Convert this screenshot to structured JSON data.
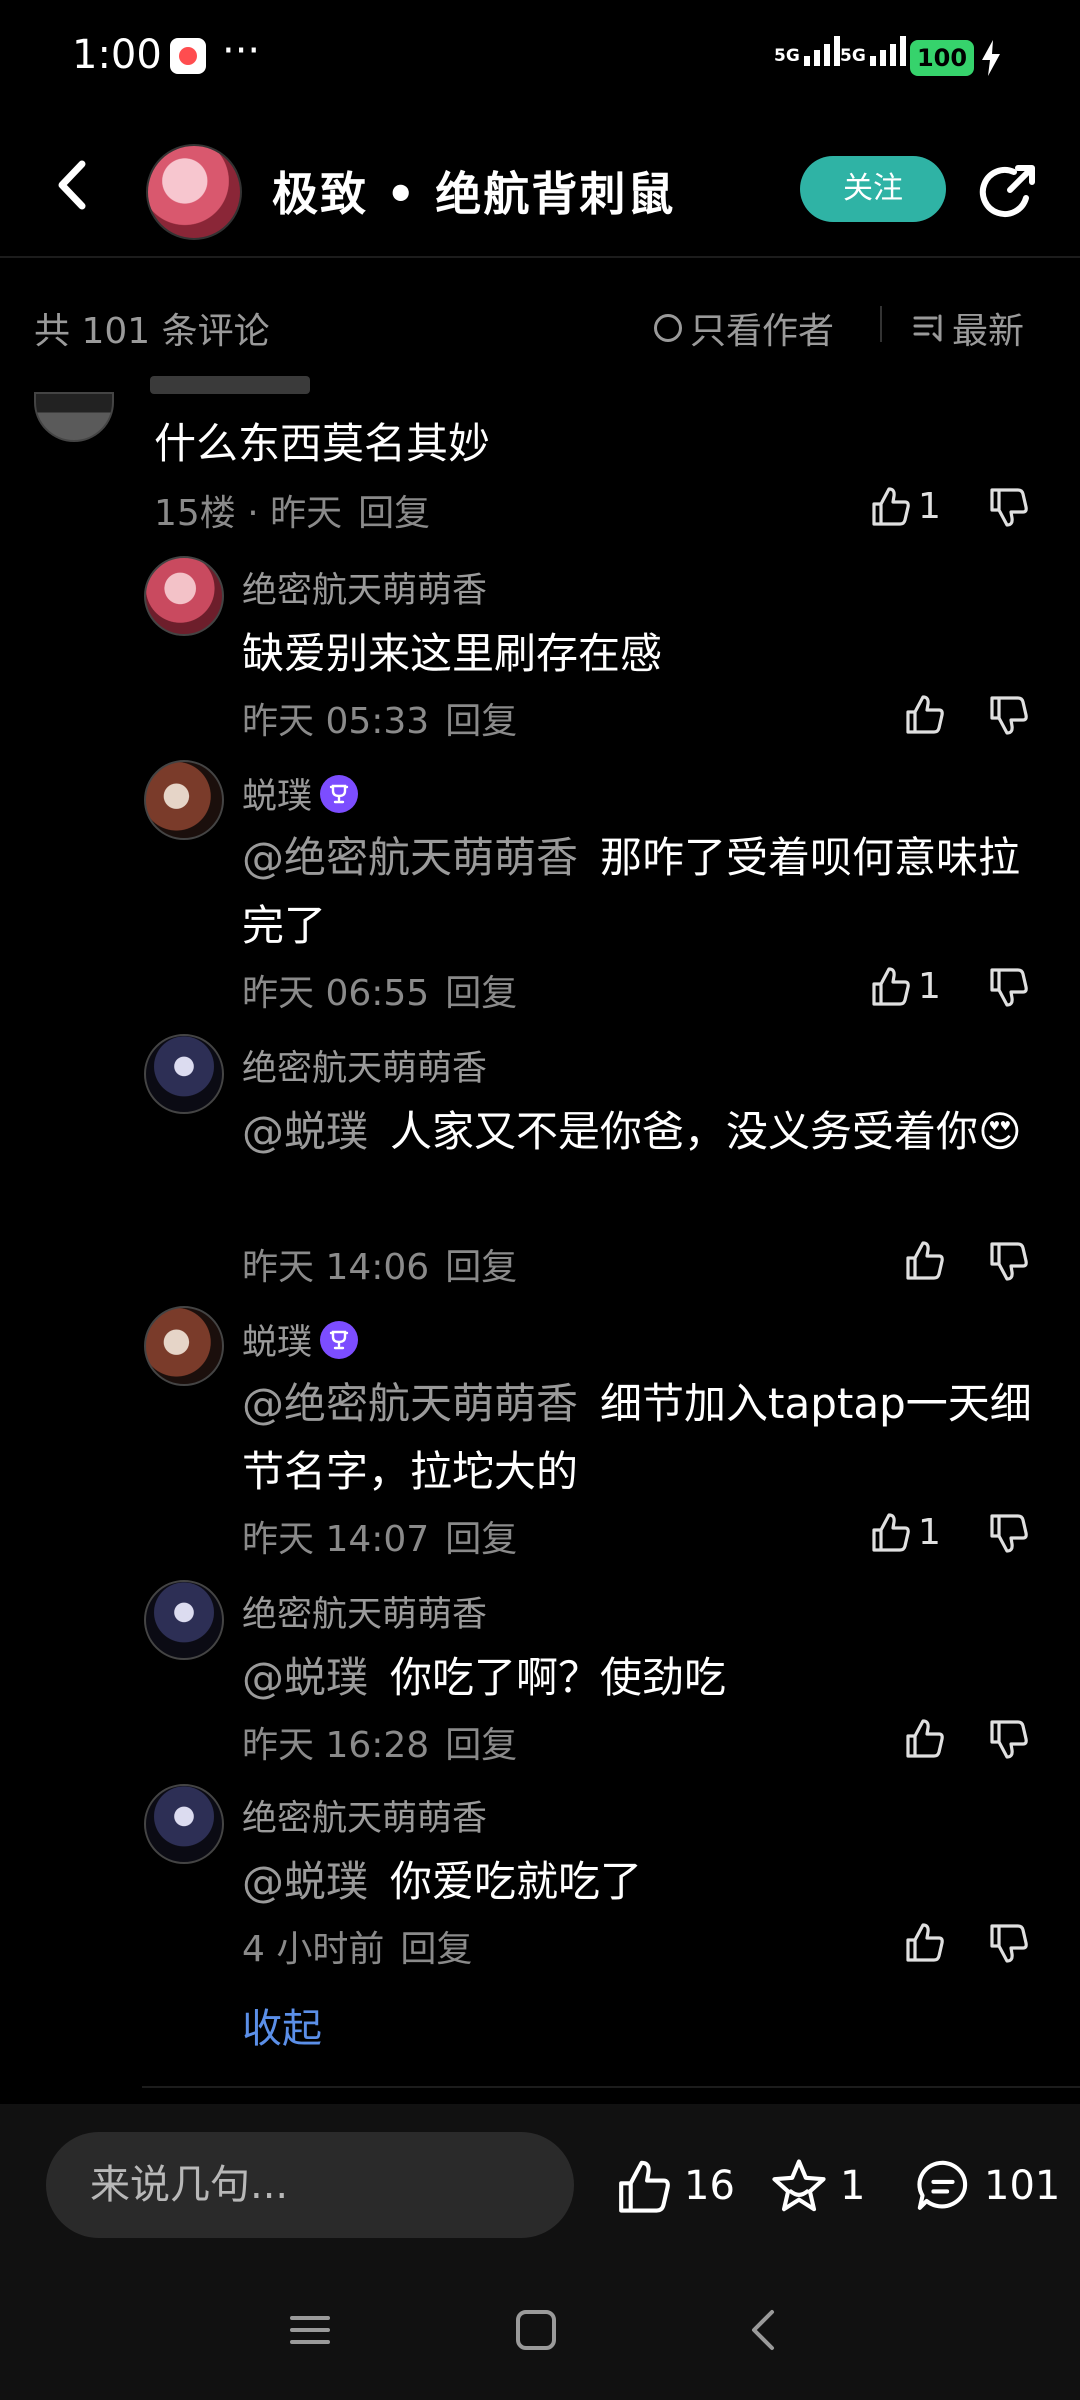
{
  "status_bar": {
    "time": "1:00",
    "more": "···",
    "net1": "5G",
    "net2": "5G",
    "battery": "100"
  },
  "header": {
    "title": "极致 • 绝航背刺鼠",
    "follow_label": "关注"
  },
  "comments_header": {
    "total": "共 101 条评论",
    "only_author": "只看作者",
    "sort": "最新"
  },
  "top_comment": {
    "text": "什么东西莫名其妙",
    "floor_time": "15楼 · 昨天",
    "reply": "回复",
    "likes": "1"
  },
  "replies": [
    {
      "name": "绝密航天萌萌香",
      "mention": "",
      "text": "缺爱别来这里刷存在感",
      "time": "昨天 05:33",
      "reply": "回复",
      "likes": ""
    },
    {
      "name": "蜕璞",
      "mention": "@绝密航天萌萌香",
      "text": "那咋了受着呗何意味拉完了",
      "time": "昨天 06:55",
      "reply": "回复",
      "likes": "1"
    },
    {
      "name": "绝密航天萌萌香",
      "mention": "@蜕璞",
      "text": "人家又不是你爸，没义务受着你😍",
      "time": "昨天 14:06",
      "reply": "回复",
      "likes": ""
    },
    {
      "name": "蜕璞",
      "mention": "@绝密航天萌萌香",
      "text": "细节加入taptap一天细节名字，拉坨大的",
      "time": "昨天 14:07",
      "reply": "回复",
      "likes": "1"
    },
    {
      "name": "绝密航天萌萌香",
      "mention": "@蜕璞",
      "text": "你吃了啊？使劲吃",
      "time": "昨天 16:28",
      "reply": "回复",
      "likes": ""
    },
    {
      "name": "绝密航天萌萌香",
      "mention": "@蜕璞",
      "text": "你爱吃就吃了",
      "time": "4 小时前",
      "reply": "回复",
      "likes": ""
    }
  ],
  "collapse_label": "收起",
  "bottom_bar": {
    "input_placeholder": "来说几句...",
    "likes": "16",
    "favorites": "1",
    "comments": "101"
  },
  "colors": {
    "follow": "#2fb3a5",
    "link": "#5b8fe8",
    "badge": "#7c4dff",
    "battery": "#36d36c"
  }
}
